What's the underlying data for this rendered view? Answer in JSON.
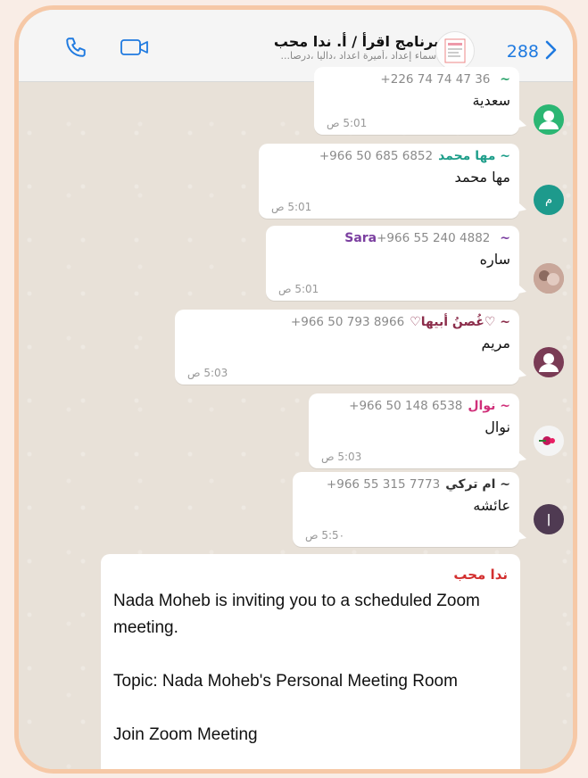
{
  "header": {
    "title": "برنامج اقرأ / أ. ندا محب",
    "subtitle": "أسماء إعداد ،أميرة اعداد ،داليا ،درصا...",
    "back_count": "288"
  },
  "messages": [
    {
      "sender": "~ ",
      "phone": "+226 74 74 47 36",
      "text": "سعدية",
      "time": "5:01 ص",
      "color": "#2aa36b"
    },
    {
      "sender": "~ مها محمد",
      "phone": "+966 50 685 6852",
      "text": "مها محمد",
      "time": "5:01 ص",
      "color": "#1e9e8a"
    },
    {
      "sender": "~ Sara",
      "phone": "+966 55 240 4882",
      "text": "ساره",
      "time": "5:01 ص",
      "color": "#7b3fa0"
    },
    {
      "sender": "~ ♡غُصنُ أبيها♡",
      "phone": "+966 50 793 8966",
      "text": "مريم",
      "time": "5:03 ص",
      "color": "#8b2c4a"
    },
    {
      "sender": "~ نوال",
      "phone": "+966 50 148 6538",
      "text": "نوال",
      "time": "5:03 ص",
      "color": "#d0307a"
    },
    {
      "sender": "~ ام تركي",
      "phone": "+966 55 315 7773",
      "text": "عائشه",
      "time": "5:5٠ ص",
      "color": "#333333"
    }
  ],
  "zoom_message": {
    "sender": "ندا محب",
    "line1": "Nada Moheb is inviting you to a scheduled Zoom meeting.",
    "line2": "Topic: Nada Moheb's Personal Meeting Room",
    "line3": "Join Zoom Meeting"
  },
  "colors": {
    "accent": "#1f7ae0",
    "border": "#f6c8a6"
  },
  "icons": [
    "phone-icon",
    "video-icon",
    "chevron-right-icon"
  ]
}
